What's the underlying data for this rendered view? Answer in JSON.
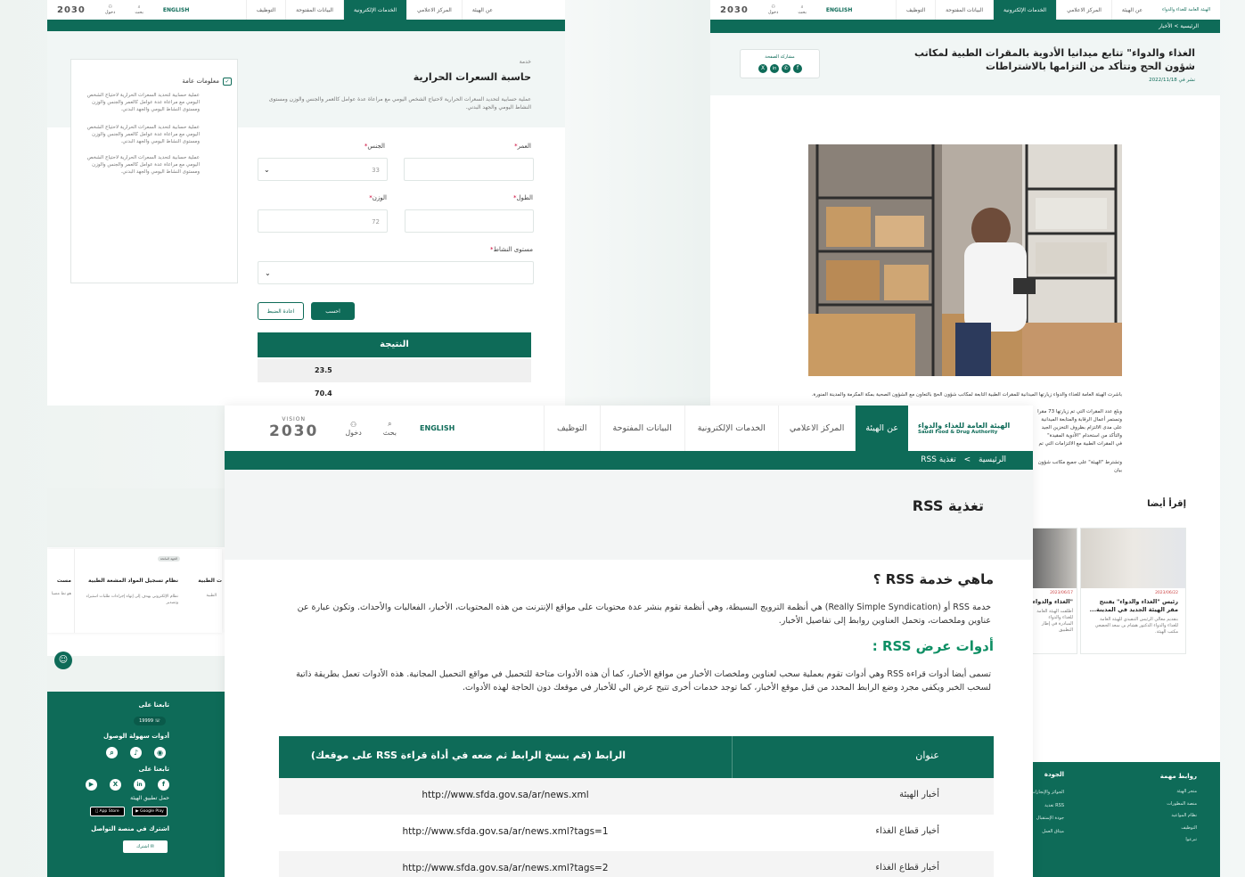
{
  "nav": {
    "items": [
      "عن الهيئة",
      "المركز الاعلامي",
      "الخدمات الإلكترونية",
      "البيانات المفتوحة",
      "التوظيف"
    ],
    "english": "ENGLISH",
    "search": "بحث",
    "login": "دخول",
    "logo_ar": "الهيئة العامة للغذاء والدواء",
    "logo_en": "Saudi Food & Drug Authority",
    "vision": "2030",
    "vision_word": "VISION"
  },
  "calc": {
    "kicker": "خدمة",
    "title": "حاسبة السعرات الحرارية",
    "desc": "عملية حسابية لتحديد السعرات الحرارية لاحتياج الشخص اليومي مع مراعاة عدة عوامل كالعمر والجنس والوزن ومستوى النشاط اليومي والجهد البدني.",
    "age_label": "العمر",
    "gender_label": "الجنس",
    "gender_value": "33",
    "height_label": "الطول",
    "weight_label": "الوزن",
    "weight_value": "72",
    "activity_label": "مستوى النشاط",
    "calc_btn": "احسب",
    "reset_btn": "اعادة الضبط",
    "result_title": "النتيجة",
    "result_1": "23.5",
    "result_2": "70.4",
    "info_title": "معلومات عامة",
    "info_text": "عملية حسابية لتحديد السعرات الحرارية لاحتياج الشخص اليومي مع مراعاة عدة عوامل كالعمر والجنس والوزن ومستوى النشاط اليومي والجهد البدني."
  },
  "news": {
    "breadcrumb_home": "الرئيسية",
    "breadcrumb_news": "الأخبار",
    "title": "الغذاء والدواء\" تتابع ميدانيا الأدوية بالمقرات الطبية لمكاتب شؤون الحج وتتأكد من التزامها بالاشتراطات",
    "date": "نشر في 2022/11/18",
    "share": "مشاركة الصفحة",
    "caption": "باشرت الهيئة العامة للغذاء والدواء زيارتها الميدانية للمقرات الطبية التابعة لمكاتب شؤون الحج بالتعاون مع الشؤون الصحية بمكة المكرمة والمدينة المنورة.",
    "p2": "وبلغ عدد المقرات التي تم زيارتها 73 مقرا",
    "p3": "وتستمر أعمال الرقابة والمتابعة الميدانية",
    "p4": "على مدى الالتزام بظروف التخزين الجيد",
    "p5": "والتأكد من استخدام \"الأدوية المقيدة\"",
    "p6": "في المقرات الطبية مع الالتزامات التي تم",
    "p7": "وتشترط \"الهيئة\" على جميع مكاتب شؤون",
    "p8": "بيان",
    "read_also": "إقرأ أيضا",
    "card1_date": "2023/06/22",
    "card1_title": "رئيس \"الغذاء والدواء\" يفتتح مقر الهيئة الجديد في المدينة...",
    "card1_text": "بتقديم معالي الرئيس التنفيذي للهيئة العامة للغذاء والدواء الدكتور هشام بن سعد الجضعي مكتب الهيئة.",
    "card2_date": "2023/06/17",
    "card2_title": "\"الغذاء والدواء\" سلامة الأغذ",
    "card2_text": "أطلقت الهيئة العامة للغذاء والدواء المبادرة في إطار التطبيق",
    "links_title": "روابط مهمة",
    "links": [
      "متجر الهيئة",
      "منصة المطورات",
      "نظام المواعيد",
      "التوظيف",
      "تبرعوا"
    ],
    "quality_title": "الجودة",
    "quality_links": [
      "الجوائز والإنجازات",
      "RSS تغذية",
      "جودة الإستقبال",
      "ميثاق العمل"
    ]
  },
  "footer_left": {
    "follow": "تابعنا على",
    "phone": "19999",
    "accessibility": "أدوات سهولة الوصول",
    "follow2": "تابعنا على",
    "download": "حمل تطبيق الهيئة",
    "app_store": "App Store",
    "google_play": "Google Play",
    "subscribe_title": "اشترك في منصة التواصل",
    "subscribe_btn": "اشترك",
    "tag": "الجهة المانحة",
    "service_title": "نظام تسجيل المواد المشعة الطبية",
    "service_text": "نظام الإلكتروني يهدف إلى إنهاء إجراءات طلبات استيراد وتصدير",
    "service_title2": "ت الطبية",
    "service_text2": "الطبية",
    "cut_word": "مست",
    "cut_text": "هو نظ مضيا"
  },
  "rss": {
    "breadcrumb_home": "الرئيسية",
    "breadcrumb_sep": ">",
    "breadcrumb_current": "تغذية RSS",
    "title": "تغذية RSS",
    "h1": "ماهي خدمة RSS ؟",
    "p1": "خدمة RSS أو (Really Simple Syndication) هي أنظمة الترويج البسيطة، وهي أنظمة تقوم بنشر عدة محتويات على مواقع الإنترنت من هذه المحتويات، الأخبار، الفعاليات والأحداث. وتكون عبارة عن عناوين وملخصات، وتحمل العناوين روابط إلى تفاصيل الأخبار.",
    "h2": "أدوات عرض RSS :",
    "p2": "تسمى أيضا أدوات قراءة RSS وهي أدوات تقوم بعملية سحب لعناوين وملخصات الأخبار من مواقع الأخبار، كما أن هذه الأدوات متاحة للتحميل في مواقع التحميل المجانية. هذه الأدوات تعمل بطريقة ذاتية لسحب الخبر ويكفي مجرد وضع الرابط المحدد من قبل موقع الأخبار، كما توجد خدمات أخرى تتيح عرض الي للأخبار في موقعك دون الحاجة لهذه الأدوات.",
    "col_title": "عنوان",
    "col_link": "الرابط (قم بنسخ الرابط ثم ضعه في أداة قراءة RSS على موقعك)",
    "rows": [
      {
        "title": "أخبار الهيئة",
        "link": "http://www.sfda.gov.sa/ar/news.xml"
      },
      {
        "title": "أخبار قطاع الغذاء",
        "link": "http://www.sfda.gov.sa/ar/news.xml?tags=1"
      },
      {
        "title": "أخبار قطاع الغذاء",
        "link": "http://www.sfda.gov.sa/ar/news.xml?tags=2"
      }
    ]
  },
  "colors": {
    "brand": "#0e6b58",
    "brand_light": "#e8f1ef"
  }
}
